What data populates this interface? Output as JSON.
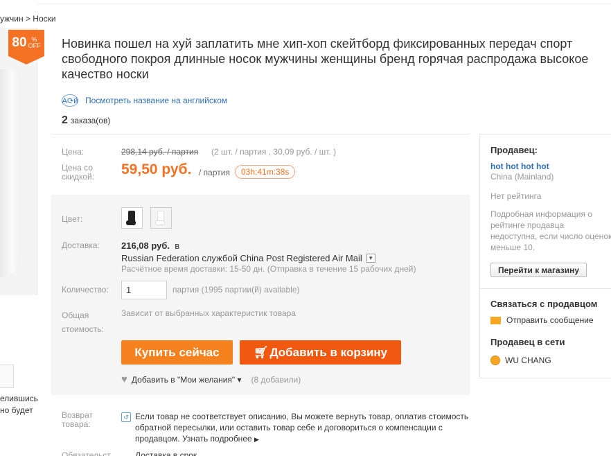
{
  "breadcrumb": {
    "text": "ужчин > Носки"
  },
  "badge": {
    "value": "80",
    "unit": "%",
    "off": "OFF"
  },
  "left_text": {
    "line1": "елившись",
    "line2": "но будет"
  },
  "product": {
    "title": "Новинка пошел на хуй заплатить мне хип-хоп скейтборд фиксированных передач спорт свободного покроя длинные носок мужчины женщины бренд горячая распродажа высокое качество носки",
    "translate_icon": "A⟳й",
    "translate_link": "Посмотреть название на английском",
    "orders_count": "2",
    "orders_label": "заказа(ов)"
  },
  "price": {
    "label": "Цена:",
    "old": "298,14 руб. / партия",
    "old_detail": "(2 шт. / партия , 30,09 руб. / шт. )",
    "discount_label_1": "Цена со",
    "discount_label_2": "скидкой:",
    "new": "59,50 руб.",
    "per": "/ партия",
    "timer": "03h:41m:38s"
  },
  "options": {
    "color_label": "Цвет:",
    "shipping_label": "Доставка:",
    "shipping_cost": "216,08 руб.",
    "shipping_to": "в",
    "shipping_method": "Russian Federation службой China Post Registered Air Mail",
    "shipping_time": "Расчётное время доставки: 15-50 дн. (Отправка в течение 15 рабочих дней)",
    "quantity_label": "Количество:",
    "quantity_value": "1",
    "quantity_info": "партия (1995 партии(й) available)",
    "total_label_1": "Общая",
    "total_label_2": "стоимость:",
    "total_value": "Зависит от выбранных характеристик товара",
    "buy_now": "Купить сейчас",
    "add_to_cart": "Добавить в корзину",
    "wishlist": "Добавить в \"Мои желания\" ▾",
    "wishlist_count": "(8 добавили)"
  },
  "returns": {
    "label_1": "Возврат",
    "label_2": "товара:",
    "text": "Если товар не соответствует описанию, Вы можете вернуть товар, оплатив стоимость обратной пересылки, или оставить товар себе и договориться о компенсации с продавцом.",
    "more": "Узнать подробнее",
    "oblig_label": "Обязательст",
    "oblig_text": "Доставка в срок"
  },
  "seller": {
    "title": "Продавец:",
    "name": "hot hot hot hot",
    "country": "China (Mainland)",
    "rating": "Нет рейтинга",
    "detail_1": "Подробная информация о",
    "detail_2": "рейтинге продавца",
    "detail_3": "недоступна, если число оценок",
    "detail_4": "меньше 10.",
    "store_button": "Перейти к магазину",
    "contact_title": "Связаться с продавцом",
    "send_message": "Отправить сообщение",
    "online_title": "Продавец в сети",
    "online_name": "WU CHANG"
  },
  "colors": {
    "accent": "#f57224",
    "link": "#2f6fb6",
    "cart": "#f0590f"
  }
}
